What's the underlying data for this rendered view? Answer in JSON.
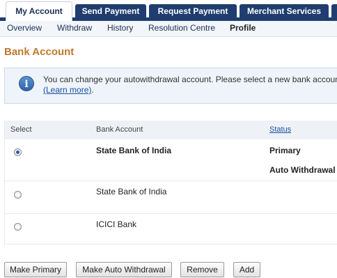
{
  "top_tabs": [
    {
      "label": "My Account",
      "active": true
    },
    {
      "label": "Send Payment",
      "active": false
    },
    {
      "label": "Request Payment",
      "active": false
    },
    {
      "label": "Merchant Services",
      "active": false
    }
  ],
  "sub_nav": [
    {
      "label": "Overview",
      "current": false
    },
    {
      "label": "Withdraw",
      "current": false
    },
    {
      "label": "History",
      "current": false
    },
    {
      "label": "Resolution Centre",
      "current": false
    },
    {
      "label": "Profile",
      "current": true
    }
  ],
  "page_title": "Bank Account",
  "info": {
    "icon": "info-icon",
    "message": "You can change your autowithdrawal account. Please select a new bank accoun",
    "link_text": "(Learn more)",
    "trailing": "."
  },
  "table": {
    "headers": {
      "select": "Select",
      "bank_account": "Bank Account",
      "status": "Status"
    },
    "rows": [
      {
        "selected": true,
        "bank": "State Bank of India",
        "bold": true,
        "status": [
          "Primary",
          "Auto Withdrawal"
        ]
      },
      {
        "selected": false,
        "bank": "State Bank of India",
        "bold": false,
        "status": []
      },
      {
        "selected": false,
        "bank": "ICICI Bank",
        "bold": false,
        "status": []
      }
    ]
  },
  "buttons": {
    "make_primary": "Make Primary",
    "make_auto_withdrawal": "Make Auto Withdrawal",
    "remove": "Remove",
    "add": "Add"
  },
  "colors": {
    "nav_blue": "#1f3d6e",
    "title_orange": "#c0772d",
    "link_blue": "#1a4fa0"
  }
}
